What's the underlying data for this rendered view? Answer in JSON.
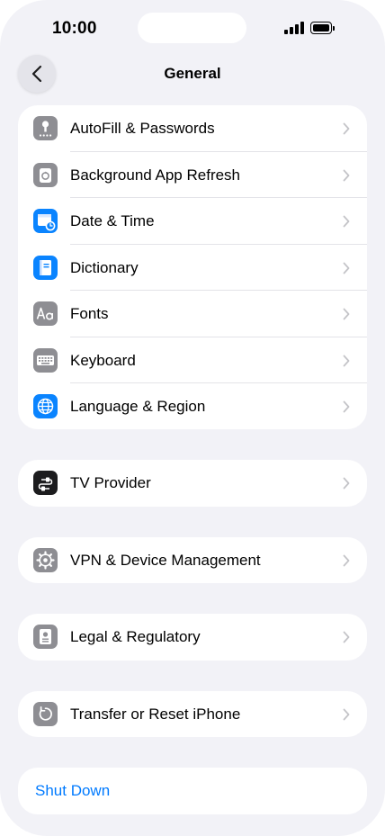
{
  "status_bar": {
    "time": "10:00"
  },
  "nav": {
    "title": "General",
    "back_icon": "chevron-left-icon"
  },
  "groups": [
    {
      "items": [
        {
          "label": "AutoFill & Passwords",
          "icon": "key-icon",
          "icon_color": "#8e8e93"
        },
        {
          "label": "Background App Refresh",
          "icon": "refresh-icon",
          "icon_color": "#8e8e93"
        },
        {
          "label": "Date & Time",
          "icon": "calendar-clock-icon",
          "icon_color": "#0a84ff"
        },
        {
          "label": "Dictionary",
          "icon": "book-icon",
          "icon_color": "#0a84ff"
        },
        {
          "label": "Fonts",
          "icon": "fonts-icon",
          "icon_color": "#8e8e93"
        },
        {
          "label": "Keyboard",
          "icon": "keyboard-icon",
          "icon_color": "#8e8e93"
        },
        {
          "label": "Language & Region",
          "icon": "globe-icon",
          "icon_color": "#0a84ff"
        }
      ]
    },
    {
      "items": [
        {
          "label": "TV Provider",
          "icon": "tv-provider-icon",
          "icon_color": "#1c1c1e"
        }
      ]
    },
    {
      "items": [
        {
          "label": "VPN & Device Management",
          "icon": "gear-icon",
          "icon_color": "#8e8e93"
        }
      ]
    },
    {
      "items": [
        {
          "label": "Legal & Regulatory",
          "icon": "document-icon",
          "icon_color": "#8e8e93"
        }
      ]
    },
    {
      "items": [
        {
          "label": "Transfer or Reset iPhone",
          "icon": "reset-icon",
          "icon_color": "#8e8e93"
        }
      ]
    }
  ],
  "shutdown": {
    "label": "Shut Down",
    "color": "#007aff"
  }
}
